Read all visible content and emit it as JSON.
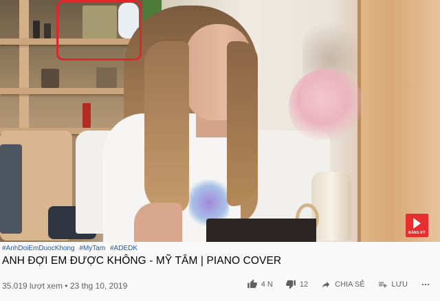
{
  "video": {
    "subscribe_label": "ĐĂNG KÝ"
  },
  "hashtags": [
    "#AnhDoiEmDuocKhong",
    "#MyTam",
    "#ADEDK"
  ],
  "title": "ANH ĐỢI EM ĐƯỢC KHÔNG - MỸ TÂM | PIANO COVER",
  "meta": {
    "views": "35.019 lượt xem",
    "separator": "•",
    "date": "23 thg 10, 2019"
  },
  "actions": {
    "like_count": "4 N",
    "dislike_count": "12",
    "share_label": "CHIA SẺ",
    "save_label": "LƯU"
  },
  "colors": {
    "hashtag": "#1f57b5",
    "highlight_box": "#e0262b",
    "subscribe": "#e62e2e"
  },
  "icons": [
    "thumbs-up-icon",
    "thumbs-down-icon",
    "share-icon",
    "playlist-add-icon",
    "more-icon",
    "play-icon"
  ]
}
